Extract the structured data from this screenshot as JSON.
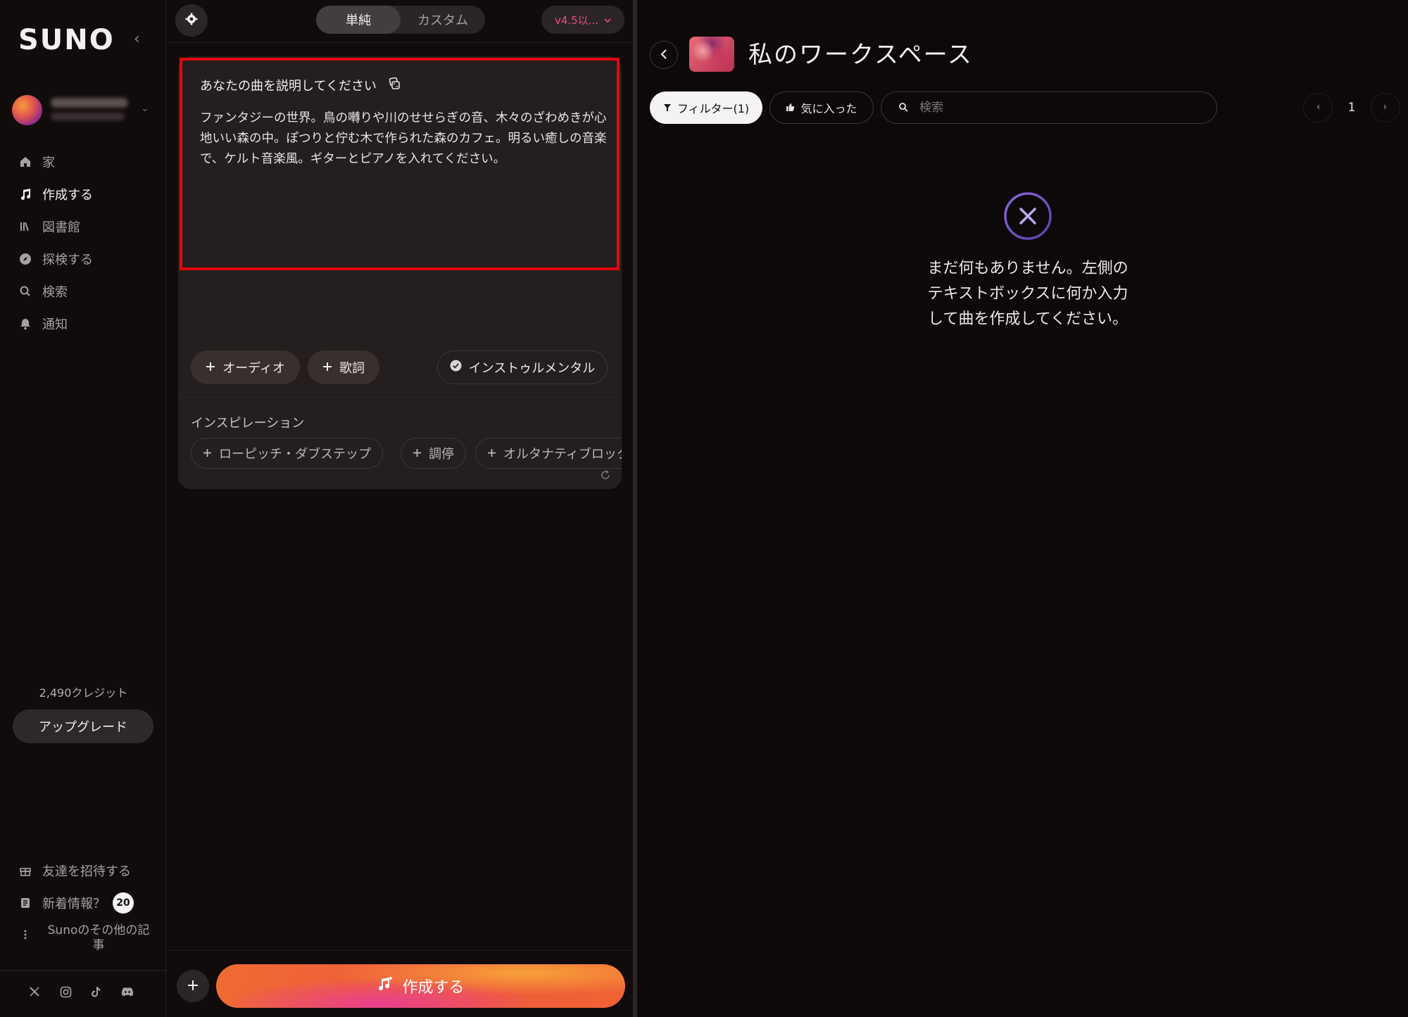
{
  "sidebar": {
    "logo": "SUNO",
    "nav": [
      {
        "label": "家",
        "icon": "home-icon"
      },
      {
        "label": "作成する",
        "icon": "music-note-icon",
        "active": true
      },
      {
        "label": "図書館",
        "icon": "library-icon"
      },
      {
        "label": "探検する",
        "icon": "compass-icon"
      },
      {
        "label": "検索",
        "icon": "search-icon"
      },
      {
        "label": "通知",
        "icon": "bell-icon"
      }
    ],
    "credits": "2,490クレジット",
    "upgrade_label": "アップグレード",
    "invite_label": "友達を招待する",
    "whats_new_label": "新着情報？",
    "whats_new_count": "20",
    "more_label": "Sunoのその他の記事"
  },
  "composer": {
    "modes": [
      {
        "label": "単純",
        "active": true
      },
      {
        "label": "カスタム",
        "active": false
      }
    ],
    "version_label": "v4.5以...",
    "prompt_label": "あなたの曲を説明してください",
    "prompt_text": "ファンタジーの世界。鳥の囀りや川のせせらぎの音、木々のざわめきが心地いい森の中。ぽつりと佇む木で作られた森のカフェ。明るい癒しの音楽で、ケルト音楽風。ギターとピアノを入れてください。",
    "audio_label": "オーディオ",
    "lyrics_label": "歌詞",
    "instrumental_label": "インストゥルメンタル",
    "inspiration_label": "インスピレーション",
    "inspirations": [
      "ローピッチ・ダブステップ",
      "調停",
      "オルタナティブロック"
    ],
    "create_label": "作成する"
  },
  "workspace": {
    "title": "私のワークスペース",
    "filter_label": "フィルター(1)",
    "liked_label": "気に入った",
    "search_placeholder": "検索",
    "page": "1",
    "empty_message": "まだ何もありません。左側のテキストボックスに何か入力して曲を作成してください。"
  },
  "colors": {
    "accent_version": "#e94a8a",
    "highlight_border": "#e0080d",
    "create_gradient_start": "#f06a33",
    "create_gradient_pink": "#e8408f"
  }
}
